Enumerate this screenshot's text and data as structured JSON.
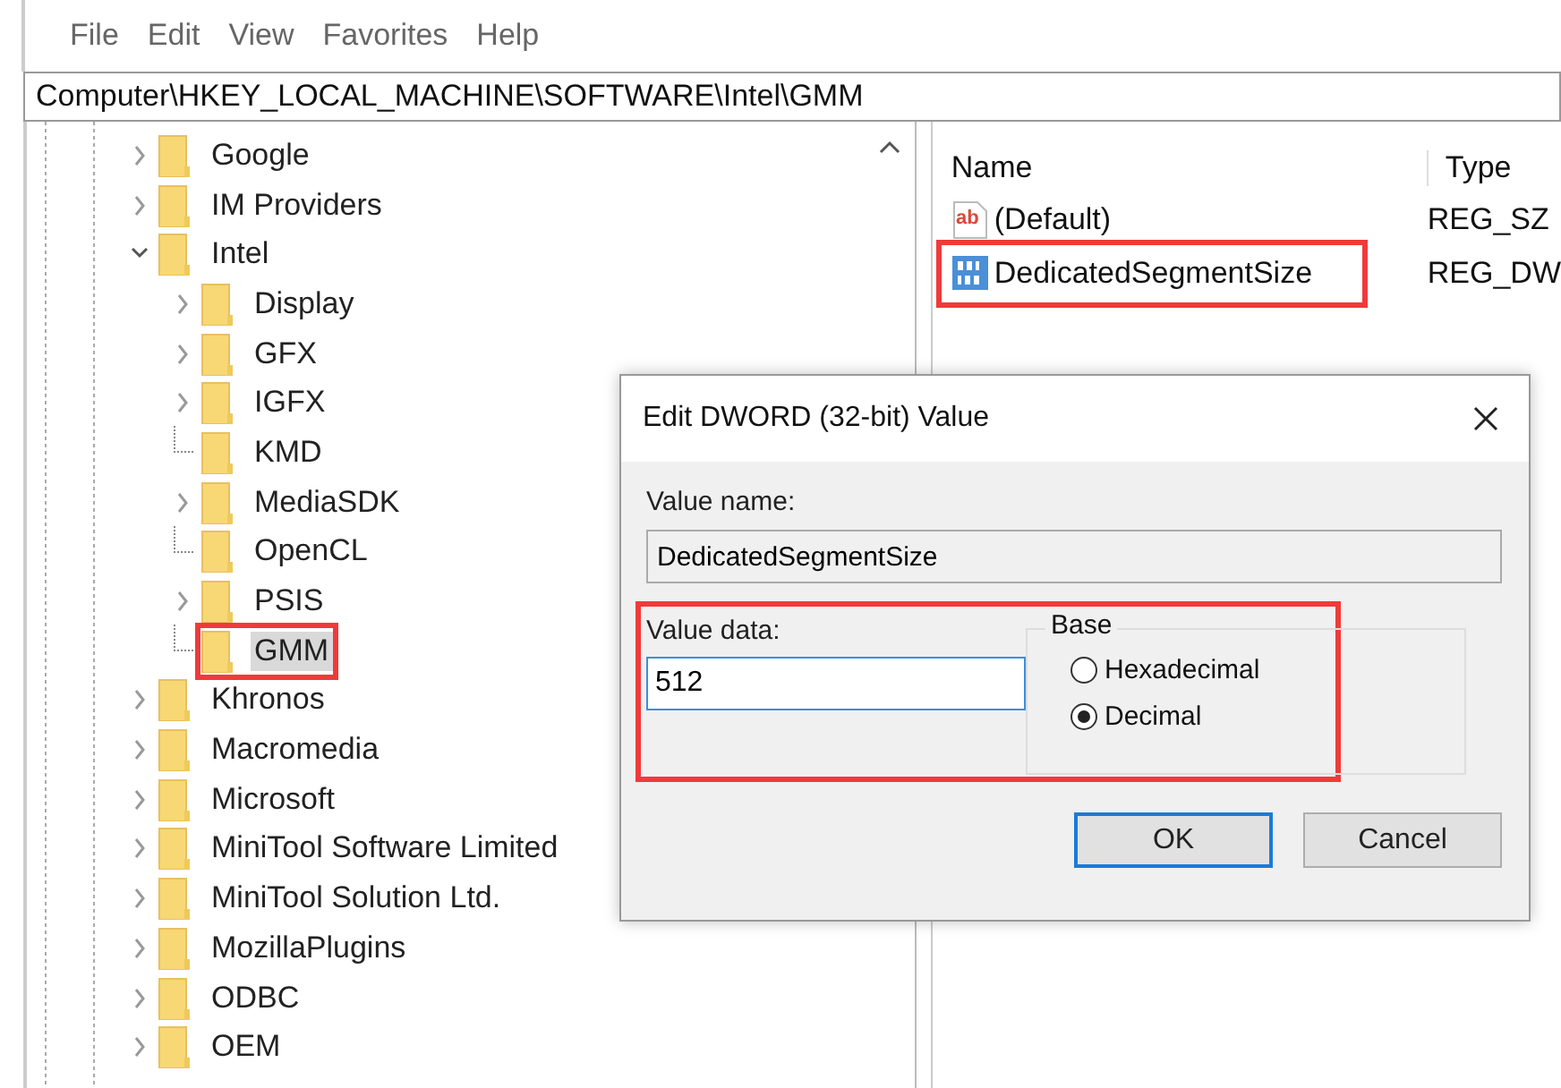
{
  "menu": [
    "File",
    "Edit",
    "View",
    "Favorites",
    "Help"
  ],
  "address": "Computer\\HKEY_LOCAL_MACHINE\\SOFTWARE\\Intel\\GMM",
  "tree": [
    {
      "label": "Google",
      "has_children": true,
      "expanded": false,
      "selected": false,
      "highlighted": false
    },
    {
      "label": "IM Providers",
      "has_children": true,
      "expanded": false,
      "selected": false,
      "highlighted": false
    },
    {
      "label": "Intel",
      "has_children": true,
      "expanded": true,
      "selected": false,
      "highlighted": false,
      "children": [
        {
          "label": "Display",
          "has_children": true,
          "expanded": false,
          "selected": false,
          "highlighted": false
        },
        {
          "label": "GFX",
          "has_children": true,
          "expanded": false,
          "selected": false,
          "highlighted": false
        },
        {
          "label": "IGFX",
          "has_children": true,
          "expanded": false,
          "selected": false,
          "highlighted": false
        },
        {
          "label": "KMD",
          "has_children": false,
          "selected": false,
          "highlighted": false
        },
        {
          "label": "MediaSDK",
          "has_children": true,
          "expanded": false,
          "selected": false,
          "highlighted": false
        },
        {
          "label": "OpenCL",
          "has_children": false,
          "selected": false,
          "highlighted": false
        },
        {
          "label": "PSIS",
          "has_children": true,
          "expanded": false,
          "selected": false,
          "highlighted": false
        },
        {
          "label": "GMM",
          "has_children": false,
          "selected": true,
          "highlighted": true
        }
      ]
    },
    {
      "label": "Khronos",
      "has_children": true,
      "expanded": false,
      "selected": false,
      "highlighted": false
    },
    {
      "label": "Macromedia",
      "has_children": true,
      "expanded": false,
      "selected": false,
      "highlighted": false
    },
    {
      "label": "Microsoft",
      "has_children": true,
      "expanded": false,
      "selected": false,
      "highlighted": false
    },
    {
      "label": "MiniTool Software Limited",
      "has_children": true,
      "expanded": false,
      "selected": false,
      "highlighted": false
    },
    {
      "label": "MiniTool Solution Ltd.",
      "has_children": true,
      "expanded": false,
      "selected": false,
      "highlighted": false
    },
    {
      "label": "MozillaPlugins",
      "has_children": true,
      "expanded": false,
      "selected": false,
      "highlighted": false
    },
    {
      "label": "ODBC",
      "has_children": true,
      "expanded": false,
      "selected": false,
      "highlighted": false
    },
    {
      "label": "OEM",
      "has_children": true,
      "expanded": false,
      "selected": false,
      "highlighted": false
    }
  ],
  "values": {
    "columns": [
      "Name",
      "Type"
    ],
    "rows": [
      {
        "kind": "string",
        "icon_text": "ab",
        "name": "(Default)",
        "type": "REG_SZ",
        "highlighted": false
      },
      {
        "kind": "dword",
        "name": "DedicatedSegmentSize",
        "type": "REG_DW",
        "highlighted": true
      }
    ]
  },
  "dialog": {
    "title": "Edit DWORD (32-bit) Value",
    "value_name_label": "Value name:",
    "value_name": "DedicatedSegmentSize",
    "value_data_label": "Value data:",
    "value_data": "512",
    "data_highlighted": true,
    "base_label": "Base",
    "base_options": [
      {
        "label": "Hexadecimal",
        "selected": false
      },
      {
        "label": "Decimal",
        "selected": true
      }
    ],
    "buttons": [
      {
        "label": "OK",
        "default": true
      },
      {
        "label": "Cancel",
        "default": false
      }
    ]
  }
}
